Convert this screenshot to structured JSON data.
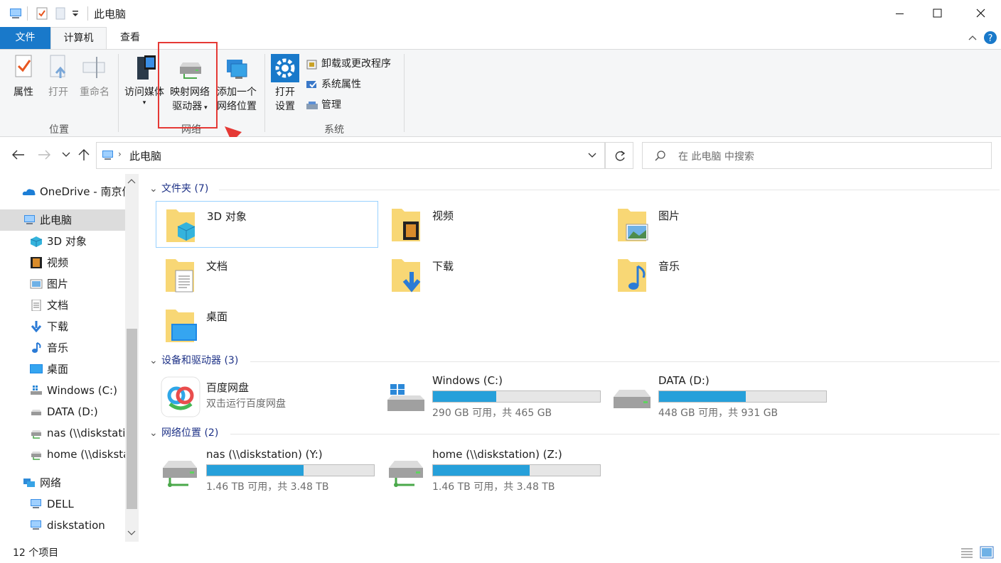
{
  "window": {
    "title": "此电脑"
  },
  "ribbon_tabs": [
    {
      "label": "文件"
    },
    {
      "label": "计算机"
    },
    {
      "label": "查看"
    }
  ],
  "ribbon": {
    "location": {
      "group_label": "位置",
      "properties": "属性",
      "open": "打开",
      "rename": "重命名"
    },
    "network": {
      "group_label": "网络",
      "access_media": "访问媒体",
      "map_drive_1": "映射网络",
      "map_drive_2": "驱动器",
      "add_location_1": "添加一个",
      "add_location_2": "网络位置"
    },
    "system": {
      "group_label": "系统",
      "open_settings_1": "打开",
      "open_settings_2": "设置",
      "uninstall": "卸载或更改程序",
      "system_properties": "系统属性",
      "manage": "管理"
    }
  },
  "address": {
    "path": "此电脑",
    "search_placeholder": "在 此电脑 中搜索"
  },
  "nav": {
    "items": [
      {
        "label": "OneDrive - 南京信"
      },
      {
        "label": "此电脑"
      },
      {
        "label": "3D 对象"
      },
      {
        "label": "视频"
      },
      {
        "label": "图片"
      },
      {
        "label": "文档"
      },
      {
        "label": "下载"
      },
      {
        "label": "音乐"
      },
      {
        "label": "桌面"
      },
      {
        "label": "Windows (C:)"
      },
      {
        "label": "DATA (D:)"
      },
      {
        "label": "nas (\\\\diskstation"
      },
      {
        "label": "home (\\\\diskstati"
      },
      {
        "label": "网络"
      },
      {
        "label": "DELL"
      },
      {
        "label": "diskstation"
      }
    ]
  },
  "sections": {
    "folders": {
      "header": "文件夹 (7)",
      "items": [
        "3D 对象",
        "视频",
        "图片",
        "文档",
        "下载",
        "音乐",
        "桌面"
      ]
    },
    "devices": {
      "header": "设备和驱动器 (3)",
      "baidu": {
        "name": "百度网盘",
        "sub": "双击运行百度网盘"
      },
      "drives": [
        {
          "name": "Windows (C:)",
          "usage": "290 GB 可用，共 465 GB",
          "used_fraction": 0.38
        },
        {
          "name": "DATA (D:)",
          "usage": "448 GB 可用，共 931 GB",
          "used_fraction": 0.52
        }
      ]
    },
    "network_locations": {
      "header": "网络位置 (2)",
      "items": [
        {
          "name": "nas (\\\\diskstation) (Y:)",
          "usage": "1.46 TB 可用，共 3.48 TB",
          "used_fraction": 0.58
        },
        {
          "name": "home (\\\\diskstation) (Z:)",
          "usage": "1.46 TB 可用，共 3.48 TB",
          "used_fraction": 0.58
        }
      ]
    }
  },
  "status": {
    "item_count": "12 个项目"
  },
  "colors": {
    "accent": "#1979ca",
    "highlight_box": "#e53935",
    "bar_fill": "#26a0da",
    "folder": "#f8d775"
  }
}
